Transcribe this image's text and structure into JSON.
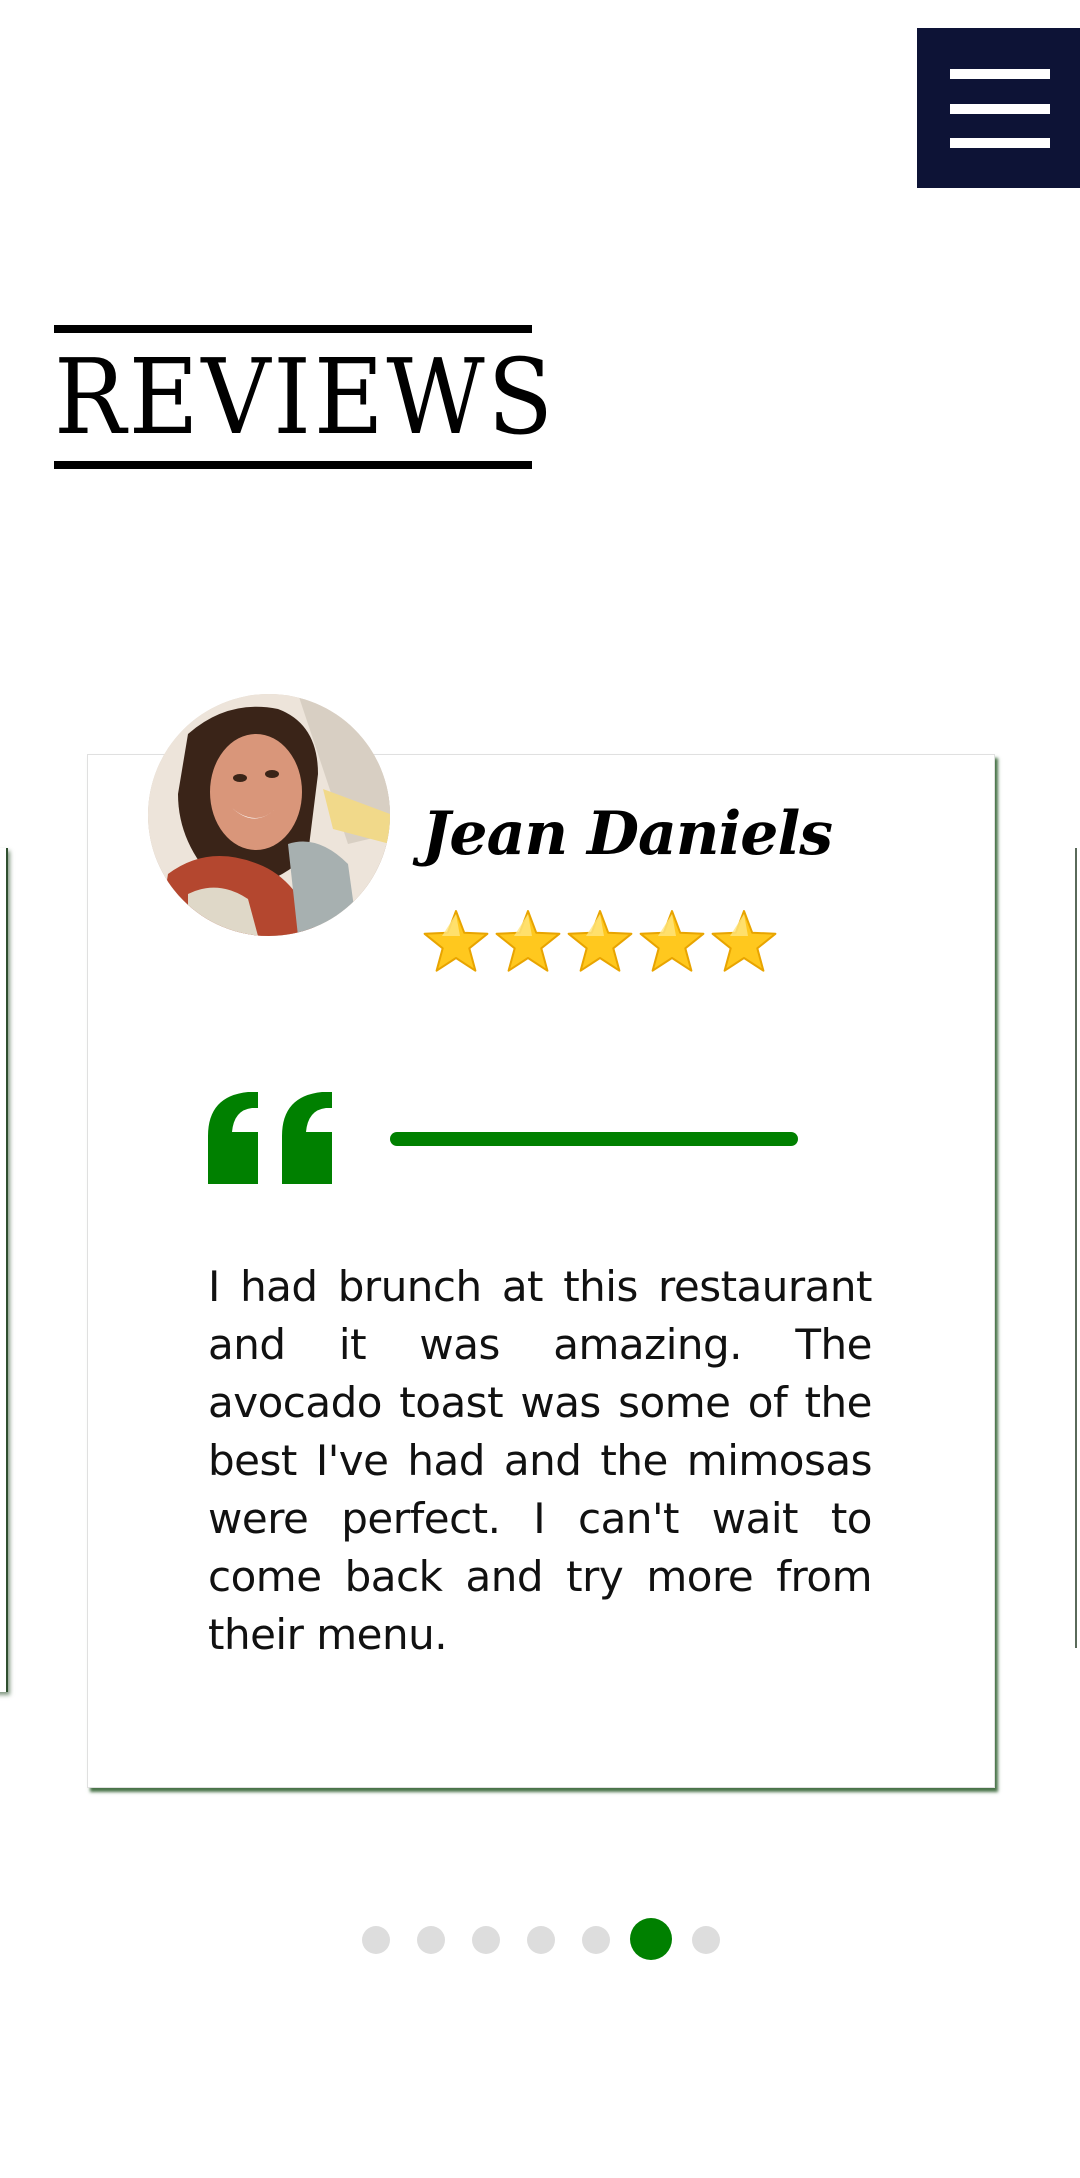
{
  "header": {
    "menu_icon": "hamburger-menu-icon",
    "menu_color": "#0d1336"
  },
  "page": {
    "title": "REVIEWS"
  },
  "review": {
    "reviewer_name": "Jean Daniels",
    "avatar_icon": "reviewer-photo",
    "rating": 5,
    "rating_max": 5,
    "star_icon": "star-icon",
    "quote_icon": "quote-mark-icon",
    "accent_color": "#008000",
    "text": "I had brunch at this restaurant and it was amazing. The avocado toast was some of the best I've had and the mimosas were perfect. I can't wait to come back and try more from their menu."
  },
  "pagination": {
    "total": 7,
    "active_index": 6,
    "active_color": "#008000",
    "inactive_color": "#dddddd"
  }
}
